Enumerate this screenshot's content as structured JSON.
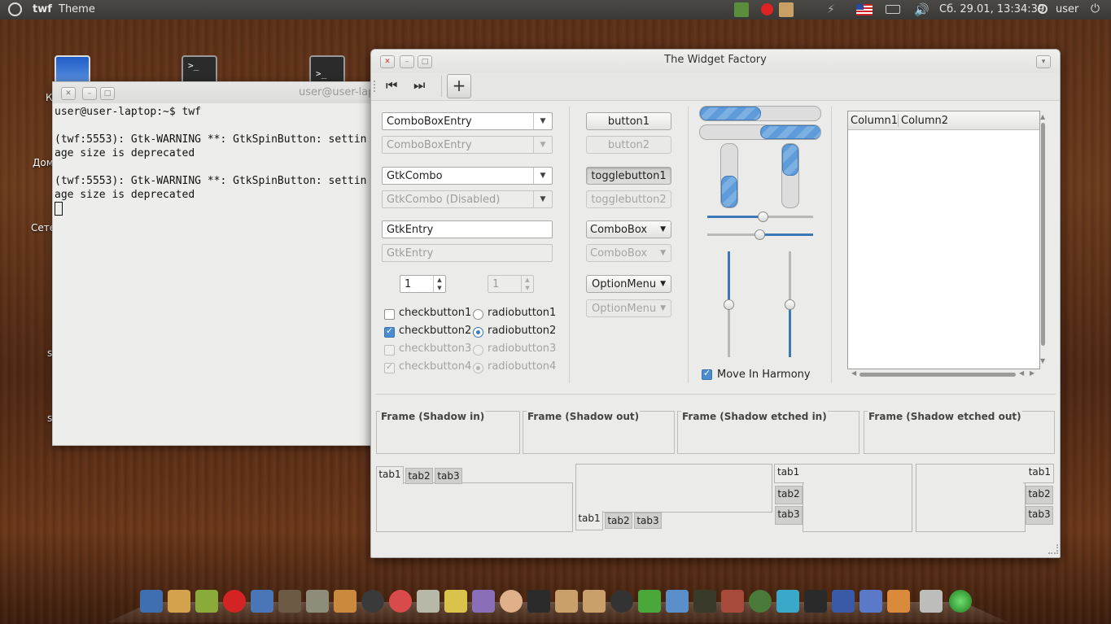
{
  "top_panel": {
    "app_name": "twf",
    "menu_theme": "Theme",
    "datetime": "Сб. 29.01, 13:34:39",
    "user": "user"
  },
  "desktop": {
    "labels": [
      "К",
      "Дом",
      "Сете",
      "s",
      "s"
    ]
  },
  "terminal": {
    "title": "user@user-lap",
    "content": "user@user-laptop:~$ twf\n\n(twf:5553): Gtk-WARNING **: GtkSpinButton: settin\nage size is deprecated\n\n(twf:5553): Gtk-WARNING **: GtkSpinButton: settin\nage size is deprecated"
  },
  "window": {
    "title": "The Widget Factory",
    "combos": [
      {
        "value": "ComboBoxEntry",
        "disabled": false
      },
      {
        "value": "ComboBoxEntry",
        "disabled": true
      },
      {
        "value": "GtkCombo",
        "disabled": false
      },
      {
        "value": "GtkCombo (Disabled)",
        "disabled": true
      }
    ],
    "entries": [
      {
        "value": "GtkEntry",
        "disabled": false
      },
      {
        "value": "GtkEntry",
        "disabled": true
      }
    ],
    "spin1": "1",
    "spin2": "1",
    "checks": [
      "checkbutton1",
      "checkbutton2",
      "checkbutton3",
      "checkbutton4"
    ],
    "radios": [
      "radiobutton1",
      "radiobutton2",
      "radiobutton3",
      "radiobutton4"
    ],
    "buttons": {
      "button1": "button1",
      "button2": "button2",
      "toggle1": "togglebutton1",
      "toggle2": "togglebutton2",
      "combobox1": "ComboBox",
      "combobox2": "ComboBox",
      "option1": "OptionMenu",
      "option2": "OptionMenu"
    },
    "progress": {
      "h1": 0.5,
      "h2": 0.5,
      "v1": 0.5,
      "v2": 0.5
    },
    "harmony_label": "Move In Harmony",
    "tree_columns": [
      "Column1",
      "Column2"
    ],
    "frames": [
      "Frame (Shadow in)",
      "Frame (Shadow out)",
      "Frame (Shadow etched in)",
      "Frame (Shadow etched out)"
    ],
    "tabs": [
      "tab1",
      "tab2",
      "tab3"
    ]
  }
}
